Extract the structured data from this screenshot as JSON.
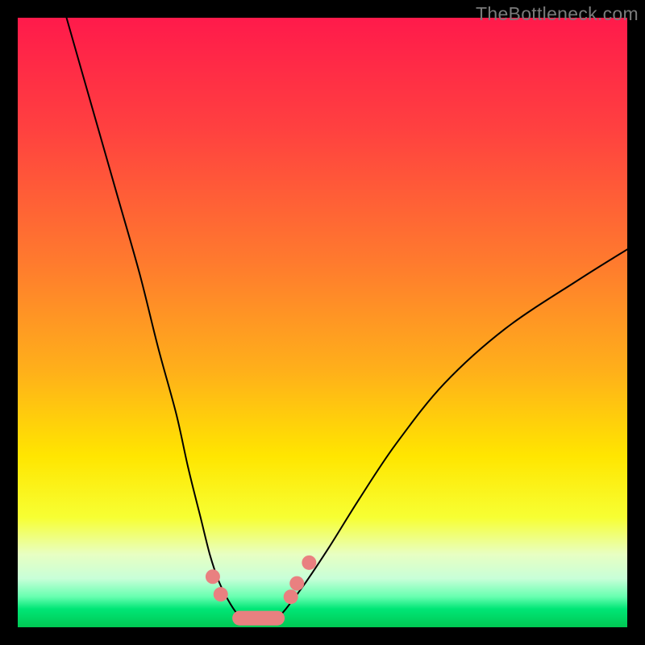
{
  "watermark": "TheBottleneck.com",
  "chart_data": {
    "type": "line",
    "title": "",
    "xlabel": "",
    "ylabel": "",
    "xlim": [
      0,
      100
    ],
    "ylim": [
      0,
      100
    ],
    "gradient_stops": [
      {
        "offset": 0,
        "color": "#ff1a4b"
      },
      {
        "offset": 18,
        "color": "#ff4040"
      },
      {
        "offset": 40,
        "color": "#ff7a2e"
      },
      {
        "offset": 58,
        "color": "#ffb01a"
      },
      {
        "offset": 72,
        "color": "#ffe600"
      },
      {
        "offset": 82,
        "color": "#f7ff33"
      },
      {
        "offset": 88,
        "color": "#e8ffc2"
      },
      {
        "offset": 92,
        "color": "#c8ffd8"
      },
      {
        "offset": 95,
        "color": "#67ffb0"
      },
      {
        "offset": 97,
        "color": "#00e676"
      },
      {
        "offset": 100,
        "color": "#00c853"
      }
    ],
    "series": [
      {
        "name": "left-curve",
        "x": [
          8,
          12,
          16,
          20,
          23,
          26,
          28,
          30,
          31.5,
          33,
          34.5,
          36,
          37.5
        ],
        "y": [
          100,
          86,
          72,
          58,
          46,
          35,
          26,
          18,
          12,
          7.5,
          4.5,
          2.2,
          0.8
        ]
      },
      {
        "name": "right-curve",
        "x": [
          42,
          44,
          47,
          51,
          56,
          62,
          70,
          80,
          92,
          100
        ],
        "y": [
          0.8,
          3,
          7,
          13,
          21,
          30,
          40,
          49,
          57,
          62
        ]
      }
    ],
    "markers": {
      "comment": "pink overlay markers near the curve minimum",
      "color": "#e98080",
      "dot_radius_px": 9,
      "pill": {
        "cx": 39.5,
        "cy": 1.5,
        "half_w": 4.3,
        "half_h": 1.2
      },
      "dots": [
        {
          "x": 32.0,
          "y": 8.3
        },
        {
          "x": 33.3,
          "y": 5.4
        },
        {
          "x": 44.8,
          "y": 5.0
        },
        {
          "x": 45.8,
          "y": 7.2
        },
        {
          "x": 47.8,
          "y": 10.6
        }
      ]
    }
  }
}
